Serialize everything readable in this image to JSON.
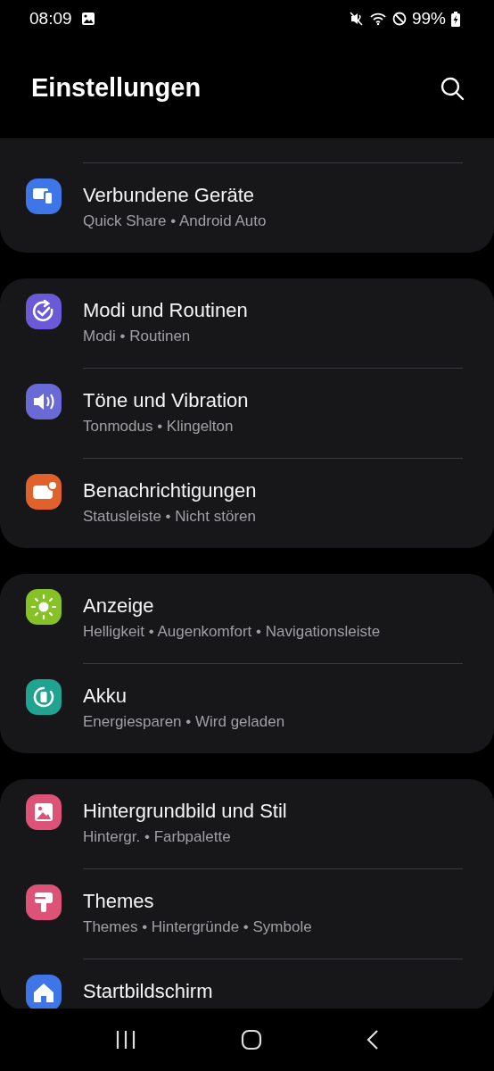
{
  "status_bar": {
    "time": "08:09",
    "battery": "99%"
  },
  "header": {
    "title": "Einstellungen"
  },
  "groups": [
    {
      "cut_top": true,
      "cut_bottom": false,
      "items": [
        {
          "title": "Verbundene Geräte",
          "subtitle": "Quick Share • Android Auto",
          "kind": "devices",
          "color": "#3e76e8"
        }
      ]
    },
    {
      "cut_top": false,
      "cut_bottom": false,
      "items": [
        {
          "title": "Modi und Routinen",
          "subtitle": "Modi • Routinen",
          "kind": "routine",
          "color": "#6b5ad8"
        },
        {
          "title": "Töne und Vibration",
          "subtitle": "Tonmodus • Klingelton",
          "kind": "sound",
          "color": "#6a6ad6"
        },
        {
          "title": "Benachrichtigungen",
          "subtitle": "Statusleiste • Nicht stören",
          "kind": "notification",
          "color": "#e0622a"
        }
      ]
    },
    {
      "cut_top": false,
      "cut_bottom": false,
      "items": [
        {
          "title": "Anzeige",
          "subtitle": "Helligkeit • Augenkomfort • Navigationsleiste",
          "kind": "display",
          "color": "#86c226"
        },
        {
          "title": "Akku",
          "subtitle": "Energiesparen • Wird geladen",
          "kind": "battery",
          "color": "#21a392"
        }
      ]
    },
    {
      "cut_top": false,
      "cut_bottom": true,
      "items": [
        {
          "title": "Hintergrundbild und Stil",
          "subtitle": "Hintergr. • Farbpalette",
          "kind": "wallpaper",
          "color": "#dd5378"
        },
        {
          "title": "Themes",
          "subtitle": "Themes • Hintergründe • Symbole",
          "kind": "themes",
          "color": "#dd5378"
        },
        {
          "title": "Startbildschirm",
          "kind": "home",
          "color": "#3e76e8"
        }
      ]
    }
  ]
}
